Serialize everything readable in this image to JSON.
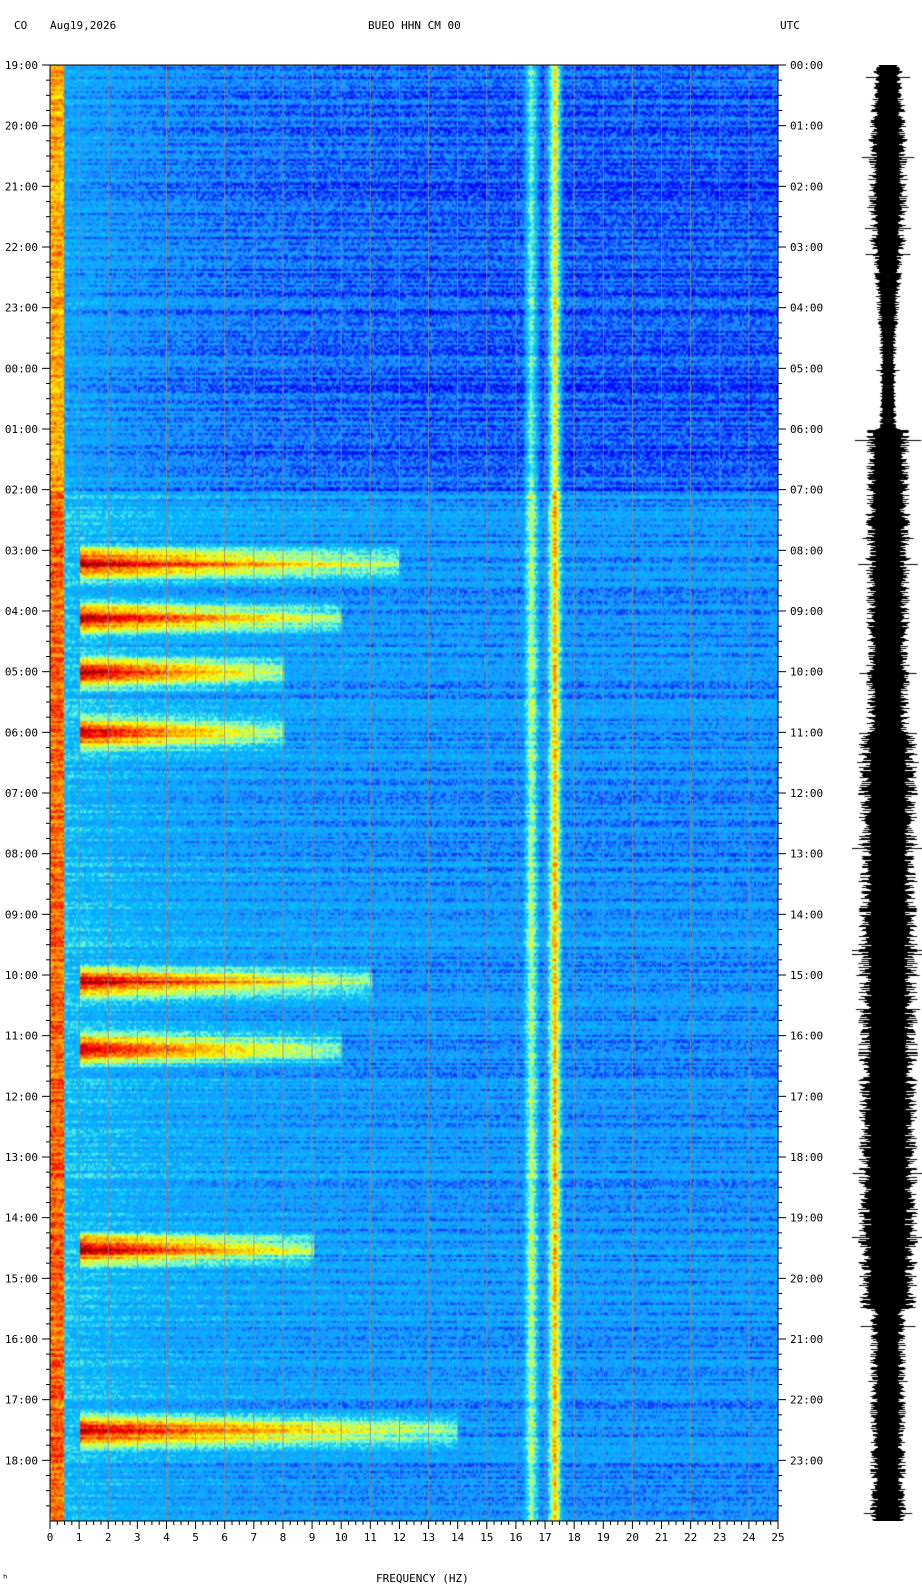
{
  "header": {
    "network": "CO",
    "date": "Aug19,2026",
    "station": "BUEO HHN CM 00",
    "timezone_right": "UTC"
  },
  "chart_data": {
    "type": "heatmap",
    "title": "BUEO HHN CM 00",
    "xlabel": "FREQUENCY (HZ)",
    "xlim": [
      0,
      25
    ],
    "x_ticks": [
      "0",
      "1",
      "2",
      "3",
      "4",
      "5",
      "6",
      "7",
      "8",
      "9",
      "10",
      "11",
      "12",
      "13",
      "14",
      "15",
      "16",
      "17",
      "18",
      "19",
      "20",
      "21",
      "22",
      "23",
      "24",
      "25"
    ],
    "y_hours": 24,
    "left_time_labels": [
      "19:00",
      "20:00",
      "21:00",
      "22:00",
      "23:00",
      "00:00",
      "01:00",
      "02:00",
      "03:00",
      "04:00",
      "05:00",
      "06:00",
      "07:00",
      "08:00",
      "09:00",
      "10:00",
      "11:00",
      "12:00",
      "13:00",
      "14:00",
      "15:00",
      "16:00",
      "17:00",
      "18:00"
    ],
    "right_time_labels": [
      "00:00",
      "01:00",
      "02:00",
      "03:00",
      "04:00",
      "05:00",
      "06:00",
      "07:00",
      "08:00",
      "09:00",
      "10:00",
      "11:00",
      "12:00",
      "13:00",
      "14:00",
      "15:00",
      "16:00",
      "17:00",
      "18:00",
      "19:00",
      "20:00",
      "21:00",
      "22:00",
      "23:00"
    ],
    "colormap": [
      "#00008b",
      "#0000ff",
      "#1e90ff",
      "#00bfff",
      "#7fffd4",
      "#ffff00",
      "#ff8c00",
      "#ff0000",
      "#8b0000"
    ],
    "persistent_lines_hz": [
      16.5,
      17.3
    ],
    "events": [
      {
        "hour": 8.2,
        "f0": 1,
        "f1": 12
      },
      {
        "hour": 9.1,
        "f0": 1,
        "f1": 10
      },
      {
        "hour": 10.0,
        "f0": 1,
        "f1": 8
      },
      {
        "hour": 11.0,
        "f0": 1,
        "f1": 8
      },
      {
        "hour": 15.1,
        "f0": 1,
        "f1": 11
      },
      {
        "hour": 16.2,
        "f0": 1,
        "f1": 10
      },
      {
        "hour": 19.5,
        "f0": 1,
        "f1": 9
      },
      {
        "hour": 22.5,
        "f0": 1,
        "f1": 14
      }
    ]
  },
  "footer": {
    "corner_mark": "ʰ"
  }
}
